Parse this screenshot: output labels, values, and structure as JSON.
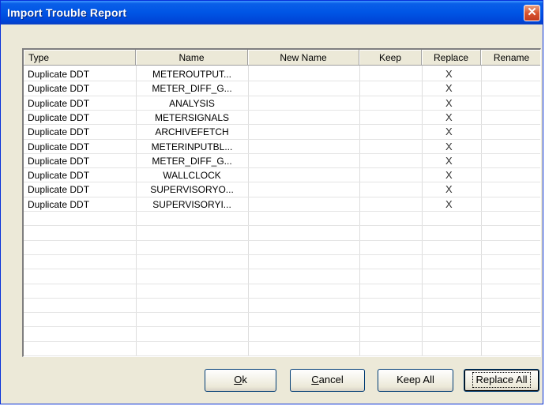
{
  "window": {
    "title": "Import Trouble Report",
    "close_glyph": "✕"
  },
  "columns": [
    "Type",
    "Name",
    "New Name",
    "Keep",
    "Replace",
    "Rename"
  ],
  "rows": [
    {
      "type": "Duplicate DDT",
      "name": "METEROUTPUT...",
      "new_name": "",
      "keep": "",
      "replace": "X",
      "rename": ""
    },
    {
      "type": "Duplicate DDT",
      "name": "METER_DIFF_G...",
      "new_name": "",
      "keep": "",
      "replace": "X",
      "rename": ""
    },
    {
      "type": "Duplicate DDT",
      "name": "ANALYSIS",
      "new_name": "",
      "keep": "",
      "replace": "X",
      "rename": ""
    },
    {
      "type": "Duplicate DDT",
      "name": "METERSIGNALS",
      "new_name": "",
      "keep": "",
      "replace": "X",
      "rename": ""
    },
    {
      "type": "Duplicate DDT",
      "name": "ARCHIVEFETCH",
      "new_name": "",
      "keep": "",
      "replace": "X",
      "rename": ""
    },
    {
      "type": "Duplicate DDT",
      "name": "METERINPUTBL...",
      "new_name": "",
      "keep": "",
      "replace": "X",
      "rename": ""
    },
    {
      "type": "Duplicate DDT",
      "name": "METER_DIFF_G...",
      "new_name": "",
      "keep": "",
      "replace": "X",
      "rename": ""
    },
    {
      "type": "Duplicate DDT",
      "name": "WALLCLOCK",
      "new_name": "",
      "keep": "",
      "replace": "X",
      "rename": ""
    },
    {
      "type": "Duplicate DDT",
      "name": "SUPERVISORYO...",
      "new_name": "",
      "keep": "",
      "replace": "X",
      "rename": ""
    },
    {
      "type": "Duplicate DDT",
      "name": "SUPERVISORYI...",
      "new_name": "",
      "keep": "",
      "replace": "X",
      "rename": ""
    }
  ],
  "buttons": {
    "ok": {
      "mnemonic": "O",
      "rest": "k"
    },
    "cancel": {
      "mnemonic": "C",
      "rest": "ancel"
    },
    "keep_all": "Keep All",
    "replace_all": "Replace All"
  },
  "colors": {
    "titlebar": "#0055e5",
    "dialog_bg": "#ece9d8",
    "close": "#d9542f"
  }
}
